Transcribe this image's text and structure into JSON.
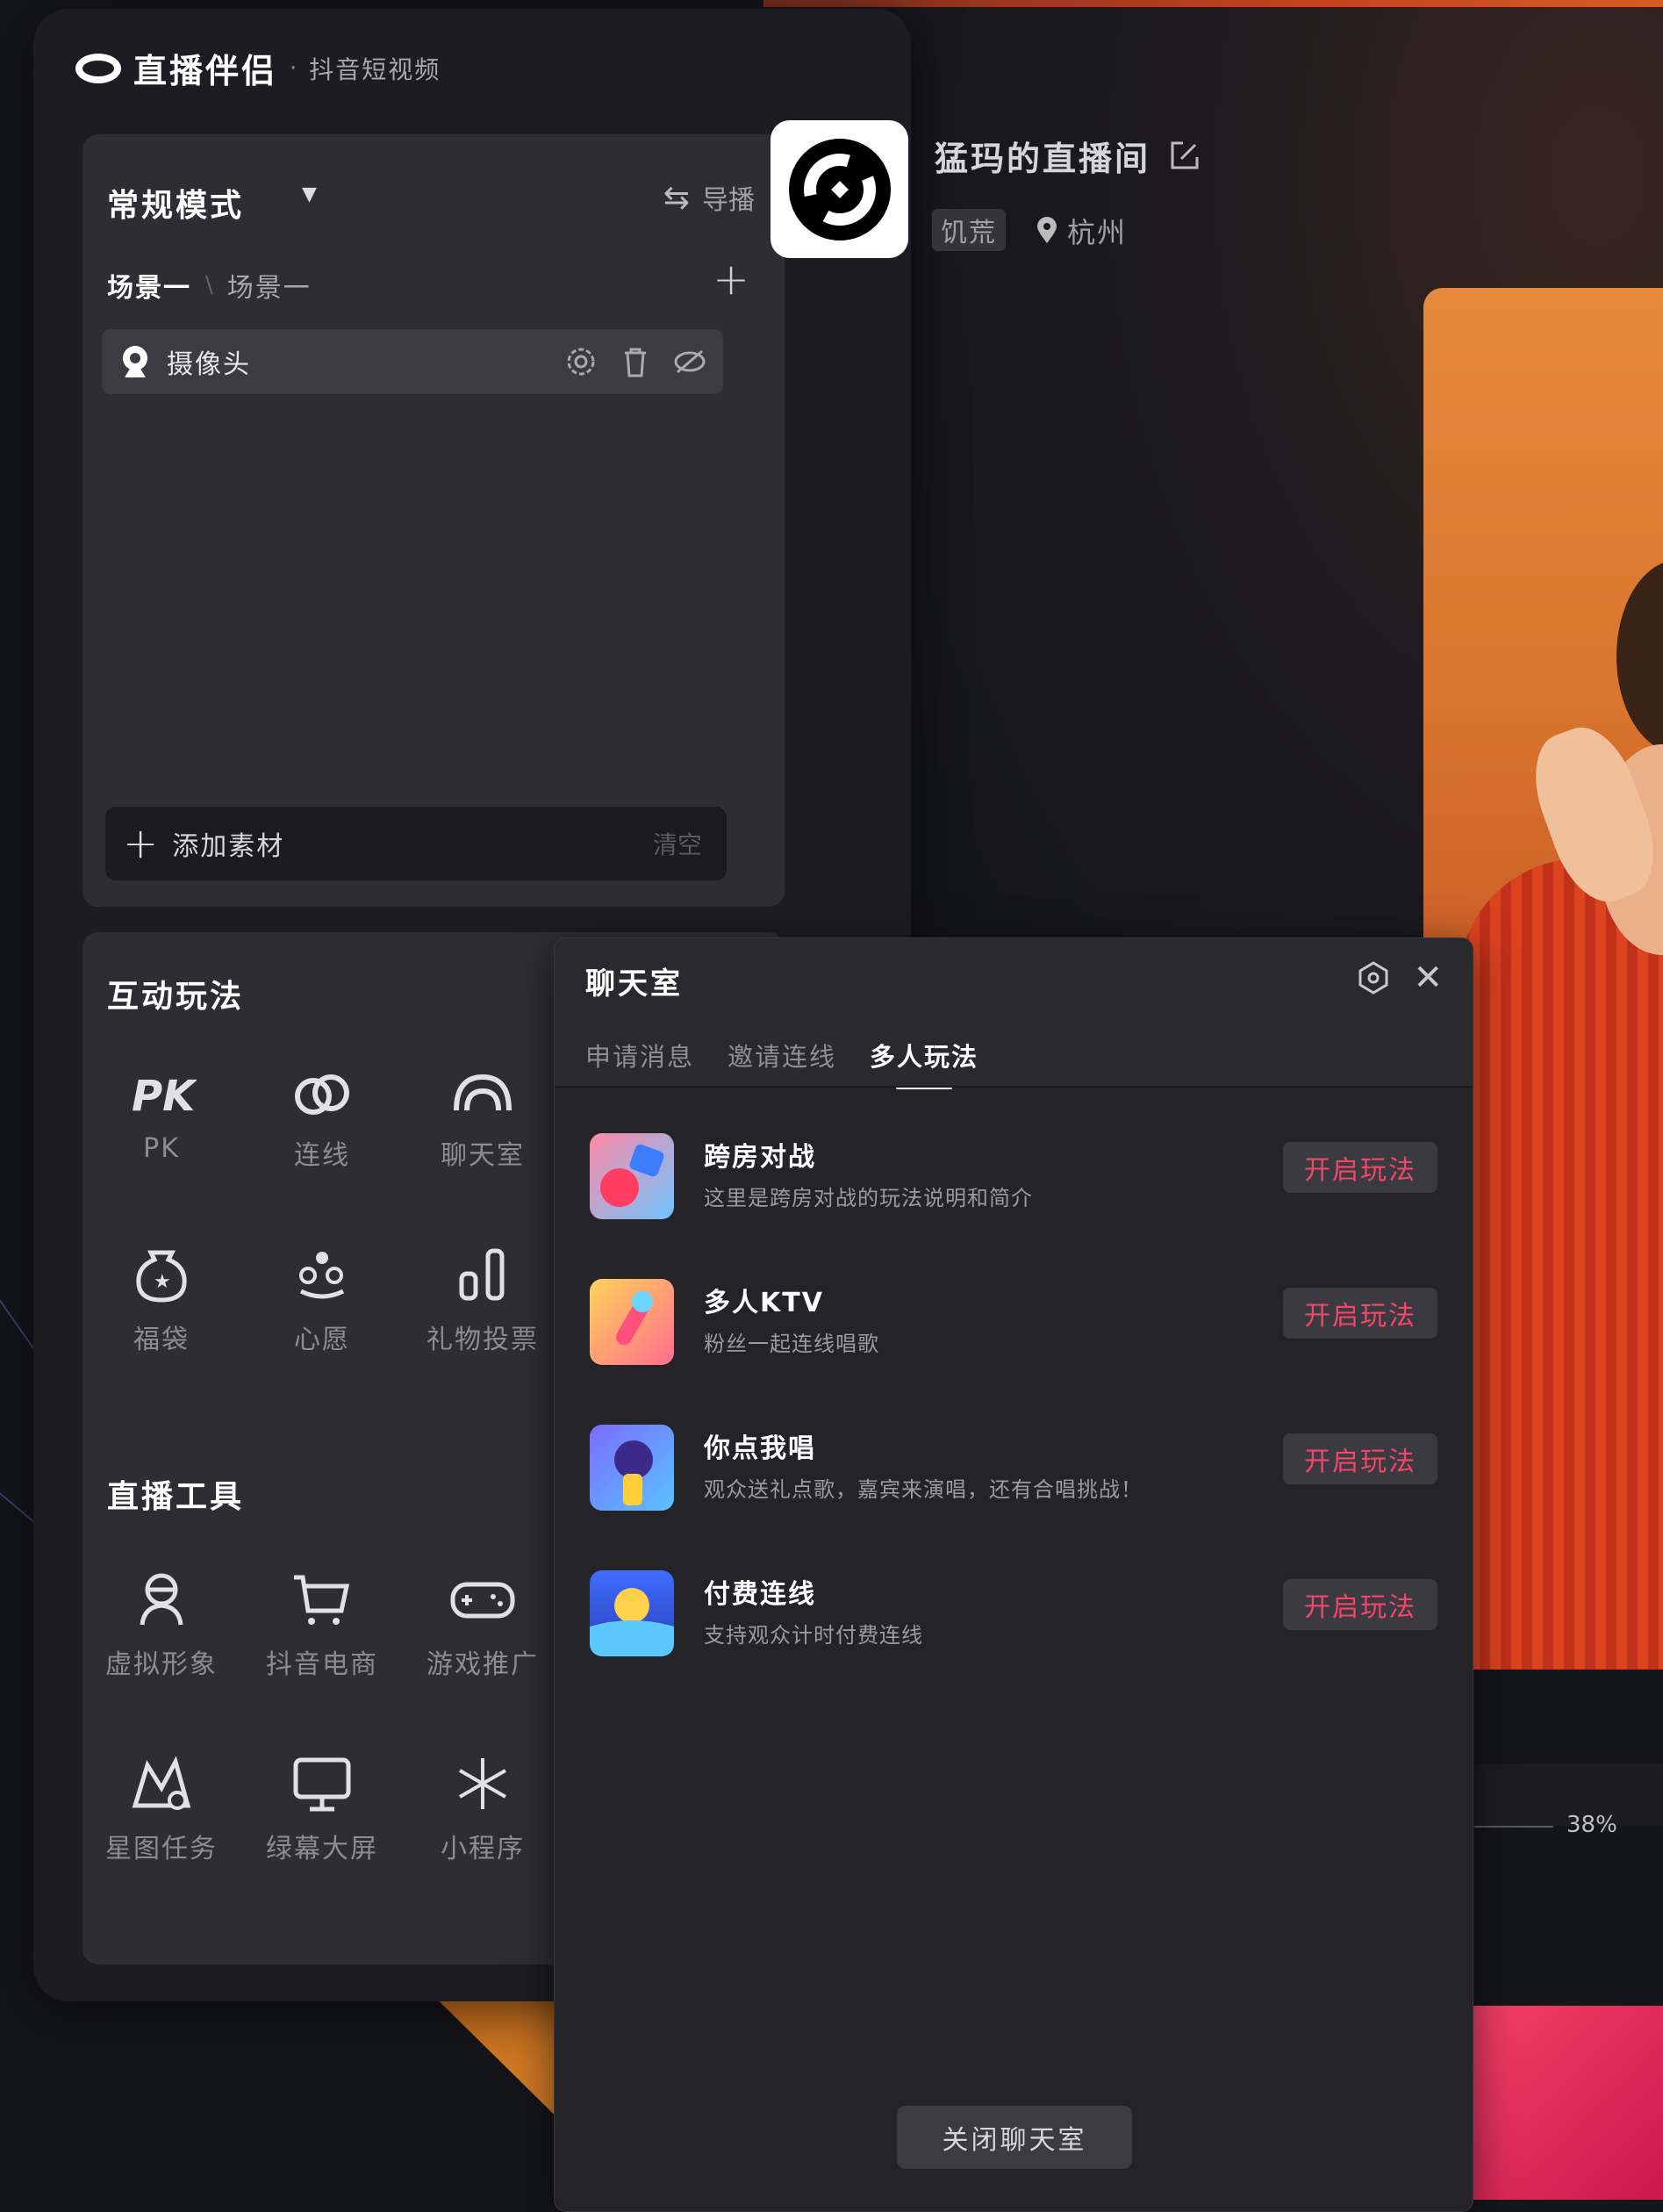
{
  "app": {
    "name": "直播伴侣",
    "separator": "·",
    "platform": "抖音短视频"
  },
  "scene_panel": {
    "mode": "常规模式",
    "guide_label": "导播",
    "breadcrumb": [
      "场景一",
      "场景一"
    ],
    "sources": [
      {
        "label": "摄像头"
      }
    ],
    "add_material_label": "添加素材",
    "clear_label": "清空"
  },
  "interactive": {
    "title": "互动玩法",
    "items": [
      {
        "label": "PK",
        "icon": "pk-icon"
      },
      {
        "label": "连线",
        "icon": "link-icon"
      },
      {
        "label": "聊天室",
        "icon": "chatroom-icon"
      },
      {
        "label": "福袋",
        "icon": "lucky-bag-icon"
      },
      {
        "label": "心愿",
        "icon": "wish-icon"
      },
      {
        "label": "礼物投票",
        "icon": "gift-vote-icon"
      }
    ]
  },
  "tools": {
    "title": "直播工具",
    "items": [
      {
        "label": "虚拟形象",
        "icon": "avatar-icon"
      },
      {
        "label": "抖音电商",
        "icon": "cart-icon"
      },
      {
        "label": "游戏推广",
        "icon": "gamepad-icon"
      },
      {
        "label": "星图任务",
        "icon": "star-map-icon"
      },
      {
        "label": "绿幕大屏",
        "icon": "monitor-icon"
      },
      {
        "label": "小程序",
        "icon": "mini-program-icon"
      }
    ]
  },
  "room": {
    "name": "猛玛的直播间",
    "tag": "饥荒",
    "location": "杭州"
  },
  "preview": {
    "percent": "38%"
  },
  "chat_room": {
    "title": "聊天室",
    "tabs": [
      "申请消息",
      "邀请连线",
      "多人玩法"
    ],
    "active_tab": "多人玩法",
    "games": [
      {
        "name": "跨房对战",
        "desc": "这里是跨房对战的玩法说明和简介",
        "button": "开启玩法"
      },
      {
        "name": "多人KTV",
        "desc": "粉丝一起连线唱歌",
        "button": "开启玩法"
      },
      {
        "name": "你点我唱",
        "desc": "观众送礼点歌，嘉宾来演唱，还有合唱挑战！",
        "button": "开启玩法"
      },
      {
        "name": "付费连线",
        "desc": "支持观众计时付费连线",
        "button": "开启玩法"
      }
    ],
    "close_label": "关闭聊天室"
  },
  "colors": {
    "accent": "#f0476a",
    "panel": "#2d2d33",
    "background": "#15161c"
  }
}
